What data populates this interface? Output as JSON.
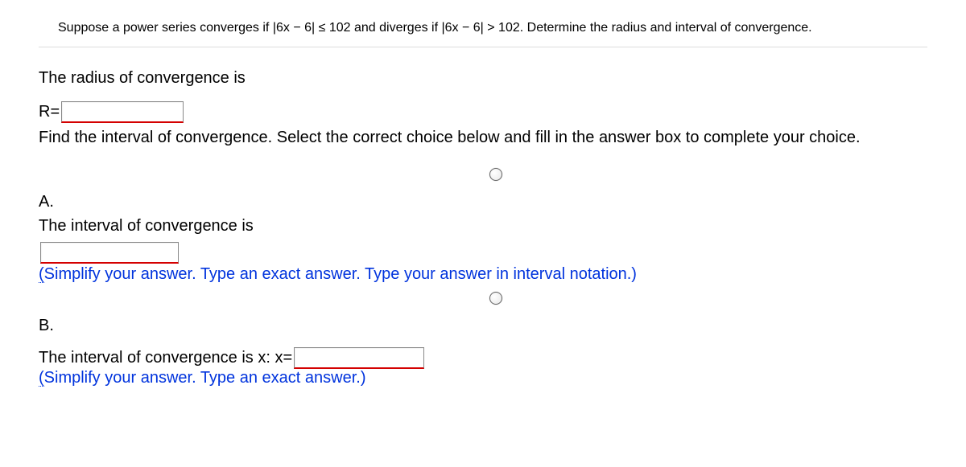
{
  "problem": "Suppose a power series converges if |6x − 6| ≤ 102 and diverges if |6x − 6| > 102. Determine the radius and interval of convergence.",
  "radius_label": "The radius of convergence is",
  "r_equals": "R=",
  "instruction": "Find the interval of convergence. Select the correct choice below and fill in the answer box to complete your choice.",
  "choiceA": {
    "label": "A.",
    "text": "The interval of convergence is",
    "hint_open": "(",
    "hint_rest": "Simplify your answer. Type an exact answer. Type your answer in interval notation.)"
  },
  "choiceB": {
    "label": "B.",
    "text": "The interval of convergence is x: x=",
    "hint_open": "(",
    "hint_rest": "Simplify your answer. Type an exact answer.)"
  }
}
